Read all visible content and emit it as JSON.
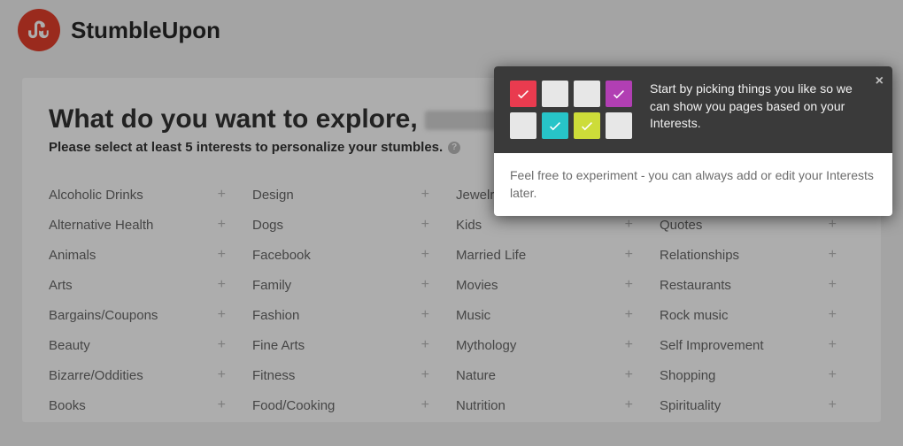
{
  "brand": "StumbleUpon",
  "heading_prefix": "What do you want to explore,",
  "subheading": "Please select at least 5 interests to personalize your stumbles.",
  "interests": [
    "Alcoholic Drinks",
    "Design",
    "Jewelry",
    "",
    "Alternative Health",
    "Dogs",
    "Kids",
    "Quotes",
    "Animals",
    "Facebook",
    "Married Life",
    "Relationships",
    "Arts",
    "Family",
    "Movies",
    "Restaurants",
    "Bargains/Coupons",
    "Fashion",
    "Music",
    "Rock music",
    "Beauty",
    "Fine Arts",
    "Mythology",
    "Self Improvement",
    "Bizarre/Oddities",
    "Fitness",
    "Nature",
    "Shopping",
    "Books",
    "Food/Cooking",
    "Nutrition",
    "Spirituality"
  ],
  "tooltip": {
    "main": "Start by picking things you like so we can show you pages based on your Interests.",
    "sub": "Feel free to experiment - you can always add or edit your Interests later.",
    "boxes": [
      {
        "checked": true,
        "color": "red"
      },
      {
        "checked": false,
        "color": ""
      },
      {
        "checked": false,
        "color": ""
      },
      {
        "checked": true,
        "color": "purple"
      },
      {
        "checked": false,
        "color": ""
      },
      {
        "checked": true,
        "color": "teal"
      },
      {
        "checked": true,
        "color": "lime"
      },
      {
        "checked": false,
        "color": ""
      }
    ]
  }
}
